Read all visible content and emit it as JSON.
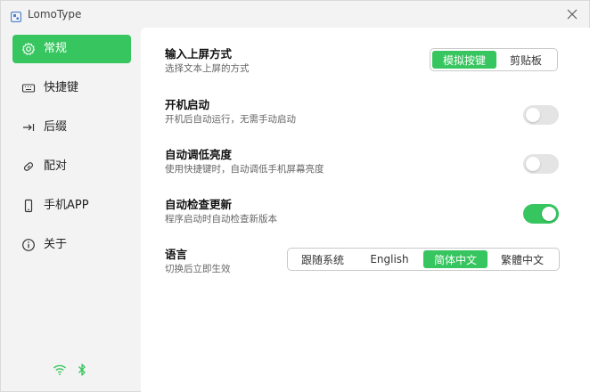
{
  "window": {
    "title": "LomoType"
  },
  "sidebar": {
    "items": [
      {
        "label": "常规",
        "icon": "gear-icon",
        "active": true
      },
      {
        "label": "快捷键",
        "icon": "keyboard-icon",
        "active": false
      },
      {
        "label": "后缀",
        "icon": "arrow-to-line-icon",
        "active": false
      },
      {
        "label": "配对",
        "icon": "link-icon",
        "active": false
      },
      {
        "label": "手机APP",
        "icon": "phone-icon",
        "active": false
      },
      {
        "label": "关于",
        "icon": "info-icon",
        "active": false
      }
    ],
    "status_icons": [
      "wifi-icon",
      "bluetooth-icon"
    ]
  },
  "settings": {
    "input_method": {
      "title": "输入上屏方式",
      "desc": "选择文本上屏的方式",
      "options": [
        "模拟按键",
        "剪贴板"
      ],
      "selected": "模拟按键"
    },
    "autostart": {
      "title": "开机启动",
      "desc": "开机后自动运行，无需手动启动",
      "enabled": false
    },
    "auto_dim": {
      "title": "自动调低亮度",
      "desc": "使用快捷键时，自动调低手机屏幕亮度",
      "enabled": false
    },
    "auto_update": {
      "title": "自动检查更新",
      "desc": "程序启动时自动检查新版本",
      "enabled": true
    },
    "language": {
      "title": "语言",
      "desc": "切换后立即生效",
      "options": [
        "跟随系统",
        "English",
        "简体中文",
        "繁體中文"
      ],
      "selected": "简体中文"
    }
  },
  "colors": {
    "accent": "#36c55e",
    "toggle_off": "#e4e4e4",
    "sidebar_bg": "#f3f3f3",
    "main_bg": "#ffffff"
  }
}
